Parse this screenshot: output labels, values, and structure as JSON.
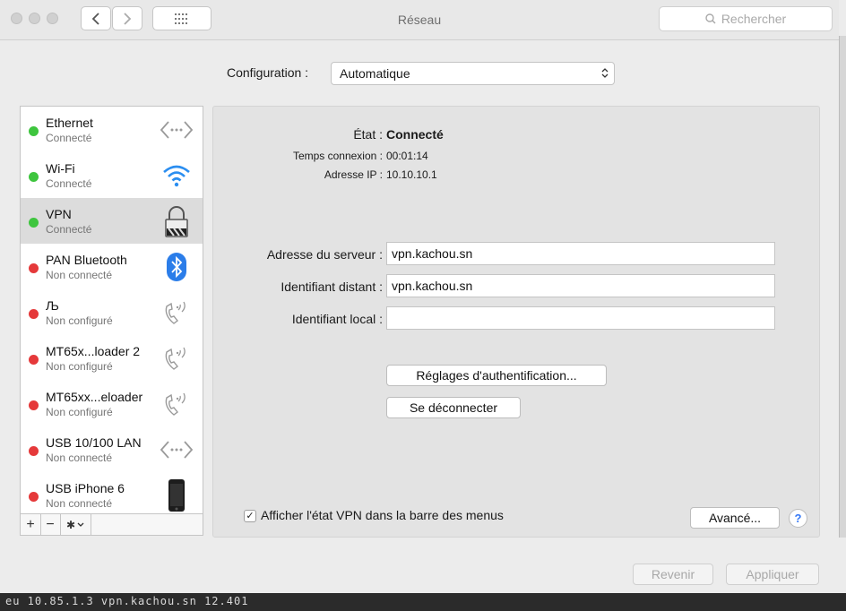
{
  "window": {
    "title": "Réseau"
  },
  "search": {
    "placeholder": "Rechercher"
  },
  "config": {
    "label": "Configuration :",
    "value": "Automatique"
  },
  "services": [
    {
      "name": "Ethernet",
      "status": "Connecté",
      "state": "connected",
      "icon": "ethernet-icon"
    },
    {
      "name": "Wi-Fi",
      "status": "Connecté",
      "state": "connected",
      "icon": "wifi-icon"
    },
    {
      "name": "VPN",
      "status": "Connecté",
      "state": "connected",
      "icon": "vpn-lock-icon",
      "selected": true
    },
    {
      "name": "PAN Bluetooth",
      "status": "Non connecté",
      "state": "disconnected",
      "icon": "bluetooth-icon"
    },
    {
      "name": "Љ",
      "status": "Non configuré",
      "state": "disconnected",
      "icon": "phone-icon"
    },
    {
      "name": "MT65x...loader 2",
      "status": "Non configuré",
      "state": "disconnected",
      "icon": "phone-icon"
    },
    {
      "name": "MT65xx...eloader",
      "status": "Non configuré",
      "state": "disconnected",
      "icon": "phone-icon"
    },
    {
      "name": "USB 10/100 LAN",
      "status": "Non connecté",
      "state": "disconnected",
      "icon": "ethernet-icon"
    },
    {
      "name": "USB iPhone 6",
      "status": "Non connecté",
      "state": "disconnected",
      "icon": "iphone-icon"
    }
  ],
  "toolbar": {
    "add": "+",
    "remove": "−",
    "gear": "✱"
  },
  "status": {
    "state_label": "État :",
    "state_value": "Connecté",
    "time_label": "Temps connexion :",
    "time_value": "00:01:14",
    "ip_label": "Adresse IP :",
    "ip_value": "10.10.10.1"
  },
  "form": {
    "server_label": "Adresse du serveur :",
    "server_value": "vpn.kachou.sn",
    "remote_label": "Identifiant distant :",
    "remote_value": "vpn.kachou.sn",
    "local_label": "Identifiant local :",
    "local_value": ""
  },
  "buttons": {
    "auth": "Réglages d'authentification...",
    "disconnect": "Se déconnecter",
    "advanced": "Avancé...",
    "help": "?",
    "revert": "Revenir",
    "apply": "Appliquer"
  },
  "show_vpn": {
    "label": "Afficher l'état VPN dans la barre des menus",
    "checked": true
  },
  "background_text": "eu   10.85.1.3   vpn.kachou.sn   12.401"
}
